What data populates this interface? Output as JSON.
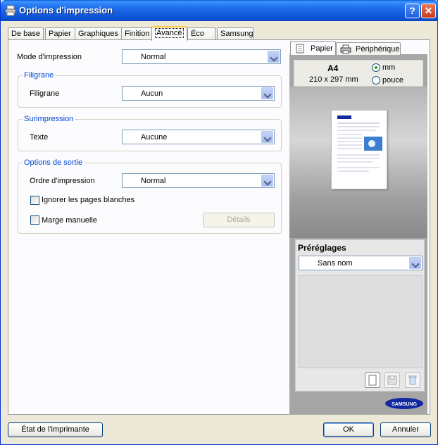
{
  "window": {
    "title": "Options d'impression"
  },
  "tabs": [
    {
      "label": "De base"
    },
    {
      "label": "Papier"
    },
    {
      "label": "Graphiques"
    },
    {
      "label": "Finition"
    },
    {
      "label": "Avancé",
      "active": true
    },
    {
      "label": "Éco"
    },
    {
      "label": "Samsung"
    }
  ],
  "print_mode": {
    "label": "Mode d'impression",
    "value": "Normal"
  },
  "watermark": {
    "group": "Filigrane",
    "label": "Filigrane",
    "value": "Aucun"
  },
  "overlay": {
    "group": "Surimpression",
    "label": "Texte",
    "value": "Aucune"
  },
  "output": {
    "group": "Options de sortie",
    "order_label": "Ordre d'impression",
    "order_value": "Normal",
    "skip_blank_label": "Ignorer les pages blanches",
    "manual_margin_label": "Marge manuelle",
    "details_label": "Détails"
  },
  "preview": {
    "tab_paper": "Papier",
    "tab_device": "Périphérique",
    "paper_name": "A4",
    "paper_size": "210 x 297 mm",
    "unit_mm": "mm",
    "unit_inch": "pouce",
    "brand_text": "SAMSUNG"
  },
  "presets": {
    "title": "Préréglages",
    "value": "Sans nom"
  },
  "footer": {
    "printer_status": "État de l'imprimante",
    "ok": "OK",
    "cancel": "Annuler"
  },
  "colors": {
    "titlebar": "#0a5ed6",
    "accent": "#0046d5",
    "samsung": "#1428a0"
  }
}
